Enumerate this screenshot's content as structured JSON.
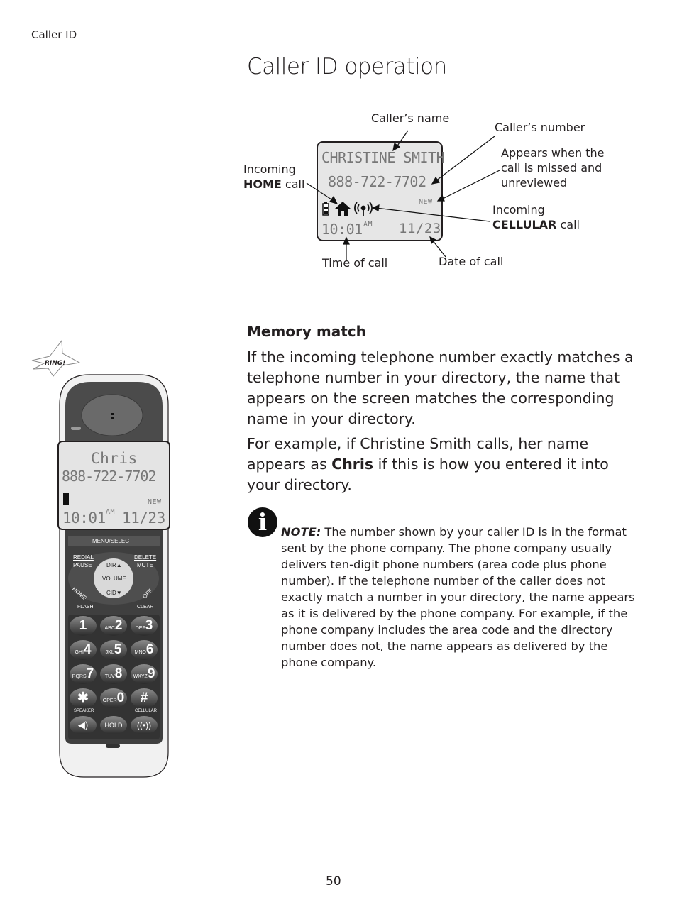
{
  "header": {
    "section": "Caller ID",
    "title": "Caller ID operation"
  },
  "diagram": {
    "screen": {
      "name": "CHRISTINE SMITH",
      "number": "888-722-7702",
      "new_indicator": "NEW",
      "time": "10:01",
      "ampm": "AM",
      "date": "11/23"
    },
    "labels": {
      "callers_name": "Caller’s name",
      "callers_number": "Caller’s number",
      "missed_1": "Appears when the",
      "missed_2": "call is missed and",
      "missed_3": "unreviewed",
      "home_1": "Incoming",
      "home_bold": "HOME",
      "home_rest": " call",
      "cell_1": "Incoming",
      "cell_bold": "CELLULAR",
      "cell_rest": " call",
      "time_of_call": "Time of call",
      "date_of_call": "Date of call"
    }
  },
  "handset": {
    "ring": "RING!",
    "screen": {
      "name": "Chris",
      "number": "888-722-7702",
      "new_indicator": "NEW",
      "time": "10:01",
      "ampm": "AM",
      "date": "11/23"
    },
    "keys": {
      "menu": "MENU/SELECT",
      "redial": "REDIAL",
      "pause": "PAUSE",
      "delete": "DELETE",
      "mute": "MUTE",
      "dir": "DIR▲",
      "volume": "VOLUME",
      "cid": "CID▼",
      "home": "HOME",
      "off": "OFF",
      "flash": "FLASH",
      "clear": "CLEAR",
      "speaker": "SPEAKER",
      "cellular": "CELLULAR",
      "hold": "HOLD"
    },
    "keypad": [
      {
        "sub": "",
        "main": "1"
      },
      {
        "sub": "ABC",
        "main": "2"
      },
      {
        "sub": "DEF",
        "main": "3"
      },
      {
        "sub": "GHI",
        "main": "4"
      },
      {
        "sub": "JKL",
        "main": "5"
      },
      {
        "sub": "MNO",
        "main": "6"
      },
      {
        "sub": "PQRS",
        "main": "7"
      },
      {
        "sub": "TUV",
        "main": "8"
      },
      {
        "sub": "WXYZ",
        "main": "9"
      },
      {
        "sub": "",
        "main": "✱"
      },
      {
        "sub": "OPER",
        "main": "0"
      },
      {
        "sub": "",
        "main": "#"
      }
    ]
  },
  "memory_match": {
    "heading": "Memory match",
    "para1": "If the incoming telephone number exactly matches a telephone number in your directory, the name that appears on the screen matches the corresponding name in your directory.",
    "para2_a": "For example, if Christine Smith calls, her name appears as ",
    "para2_bold": "Chris",
    "para2_b": " if this is how you entered it into your directory."
  },
  "note": {
    "icon": "info-icon",
    "label": "NOTE:",
    "text": " The number shown by your caller ID is in the format sent by the phone company. The phone company usually delivers ten-digit phone numbers (area code plus phone number). If the telephone number of the caller does not exactly match a number in your directory, the name appears as it is delivered by the phone company. For example, if the phone company includes the area code and the directory number does not, the name appears as delivered by the phone company."
  },
  "footer": {
    "page_number": "50"
  }
}
